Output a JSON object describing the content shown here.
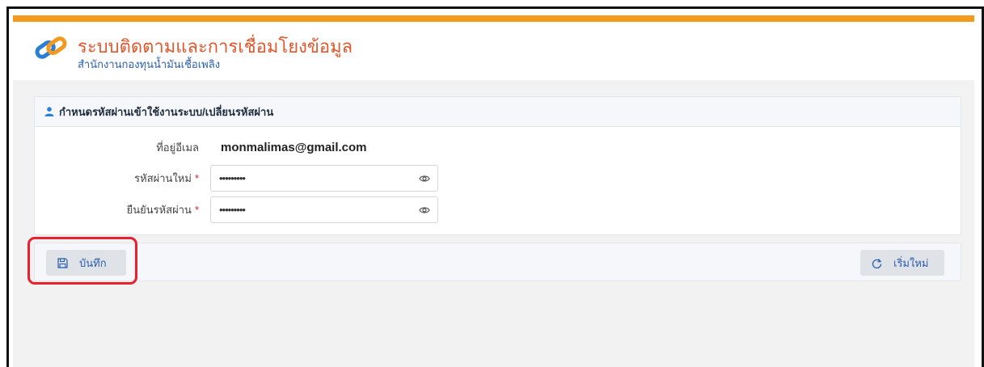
{
  "app": {
    "title": "ระบบติดตามและการเชื่อมโยงข้อมูล",
    "subtitle": "สำนักงานกองทุนน้ำมันเชื้อเพลิง"
  },
  "form": {
    "heading": "กำหนดรหัสผ่านเข้าใช้งานระบบ/เปลี่ยนรหัสผ่าน",
    "email_label": "ที่อยู่อีเมล",
    "email_value": "monmalimas@gmail.com",
    "new_password_label": "รหัสผ่านใหม่",
    "new_password_value": "•••••••••",
    "confirm_password_label": "ยืนยันรหัสผ่าน",
    "confirm_password_value": "•••••••••",
    "required_mark": "*"
  },
  "actions": {
    "save_label": "บันทึก",
    "reset_label": "เริ่มใหม่"
  },
  "icons": {
    "logo": "link-chain-logo-icon",
    "heading": "user-icon",
    "toggle_visibility": "eye-icon",
    "save": "floppy-disk-icon",
    "reset": "refresh-icon"
  },
  "colors": {
    "accent_bar": "#f39a1e",
    "title": "#e2572c",
    "subtitle": "#2a5db0",
    "required": "#d9232e",
    "highlight": "#e8212d"
  }
}
